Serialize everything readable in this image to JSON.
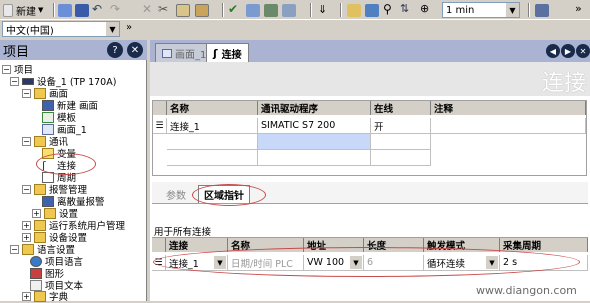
{
  "toolbar": {
    "new_label": "新建",
    "interval_value": "1 min"
  },
  "language_combo": {
    "value": "中文(中国)"
  },
  "left_panel": {
    "title": "项目",
    "tree": [
      {
        "label": "项目"
      },
      {
        "label": "设备_1 (TP 170A)"
      },
      {
        "label": "画面"
      },
      {
        "label": "新建 画面"
      },
      {
        "label": "模板"
      },
      {
        "label": "画面_1"
      },
      {
        "label": "通讯"
      },
      {
        "label": "变量"
      },
      {
        "label": "连接"
      },
      {
        "label": "周期"
      },
      {
        "label": "报警管理"
      },
      {
        "label": "离散量报警"
      },
      {
        "label": "设置"
      },
      {
        "label": "运行系统用户管理"
      },
      {
        "label": "设备设置"
      },
      {
        "label": "语言设置"
      },
      {
        "label": "项目语言"
      },
      {
        "label": "图形"
      },
      {
        "label": "项目文本"
      },
      {
        "label": "字典"
      }
    ]
  },
  "editor": {
    "tabs": [
      {
        "label": "画面_1"
      },
      {
        "label": "连接"
      }
    ],
    "big_title": "连接",
    "connections_table": {
      "headers": [
        "名称",
        "通讯驱动程序",
        "在线",
        "注释"
      ],
      "rows": [
        [
          "连接_1",
          "SIMATIC S7 200",
          "开",
          ""
        ]
      ]
    },
    "sub_tabs": [
      {
        "label": "参数"
      },
      {
        "label": "区域指针"
      }
    ],
    "section_label": "用于所有连接",
    "pointer_table": {
      "headers": [
        "连接",
        "名称",
        "地址",
        "长度",
        "触发模式",
        "采集周期"
      ],
      "row": {
        "connection": "连接_1",
        "name": "日期/时间 PLC",
        "address": "VW 100",
        "length": "6",
        "trigger": "循环连续",
        "cycle": "2 s"
      }
    }
  },
  "watermark": "www.diangon.com",
  "colors": {
    "panel_header": "#aab4d2",
    "highlight_ellipse": "#c84a4a",
    "selection_blue": "#c8d8f8"
  }
}
